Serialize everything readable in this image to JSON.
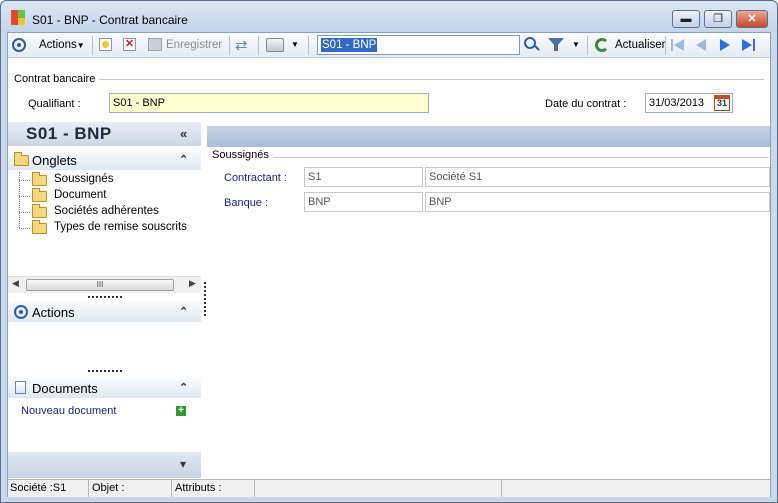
{
  "window": {
    "title": "S01 - BNP -  Contrat bancaire",
    "min": "▬",
    "max": "❐",
    "close": "✕"
  },
  "toolbar": {
    "actions_label": "Actions",
    "enregistrer_label": "Enregistrer",
    "search_value": "S01 - BNP",
    "actualiser_label": "Actualiser"
  },
  "header_section": {
    "title": "Contrat bancaire",
    "qualifiant_label": "Qualifiant :",
    "qualifiant_value": "S01 - BNP",
    "date_label": "Date du contrat :",
    "date_value": "31/03/2013",
    "cal_text": "31"
  },
  "left_panel": {
    "title": "S01 - BNP",
    "collapse": "«",
    "onglets": {
      "label": "Onglets",
      "items": [
        "Soussignés",
        "Document",
        "Sociétés adhérentes",
        "Types de remise souscrits"
      ]
    },
    "scroll_thumb": "III",
    "actions": {
      "label": "Actions"
    },
    "documents": {
      "label": "Documents",
      "new_link": "Nouveau document",
      "plus": "+"
    },
    "footer_chevron": "▾"
  },
  "main": {
    "section_title": "Soussignés",
    "rows": [
      {
        "label": "Contractant :",
        "code": "S1",
        "name": "Société S1"
      },
      {
        "label": "Banque :",
        "code": "BNP",
        "name": "BNP"
      }
    ]
  },
  "status": {
    "societe": "Société :S1",
    "objet": "Objet :",
    "attributs": "Attributs :"
  },
  "colors": {
    "accent": "#316ac5",
    "yellow_field": "#ffffd0",
    "link": "#1a237e"
  }
}
